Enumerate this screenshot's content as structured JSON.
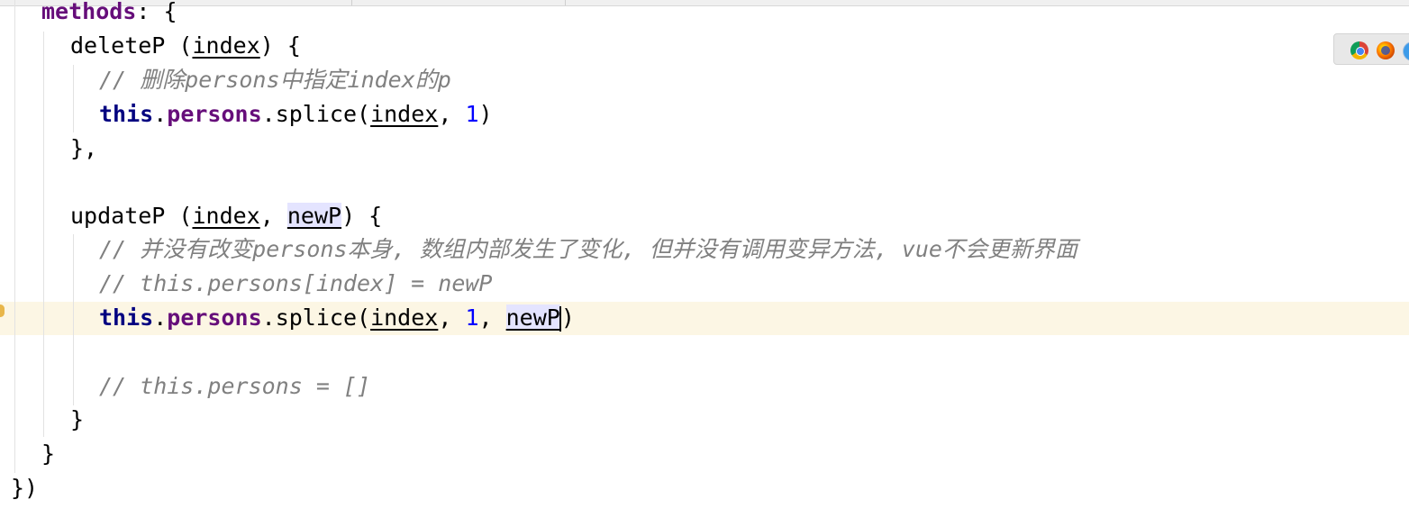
{
  "editor": {
    "lines": {
      "l0": {
        "kw": "methods",
        "rest": ": {"
      },
      "l1": {
        "name": "deleteP",
        "sp": " (",
        "p1": "index",
        "close": ") {"
      },
      "l2": {
        "comment": "// 删除persons中指定index的p"
      },
      "l3": {
        "this": "this",
        "dot1": ".",
        "prop": "persons",
        "dot2": ".",
        "fn": "splice",
        "open": "(",
        "p1": "index",
        "sep": ", ",
        "num": "1",
        "close": ")"
      },
      "l4": {
        "text": "},"
      },
      "l6": {
        "name": "updateP",
        "sp": " (",
        "p1": "index",
        "sep": ", ",
        "p2": "newP",
        "close": ") {"
      },
      "l7": {
        "comment": "// 并没有改变persons本身, 数组内部发生了变化, 但并没有调用变异方法, vue不会更新界面"
      },
      "l8": {
        "comment": "// this.persons[index] = newP"
      },
      "l9": {
        "this": "this",
        "dot1": ".",
        "prop": "persons",
        "dot2": ".",
        "fn": "splice",
        "open": "(",
        "p1": "index",
        "sep1": ", ",
        "num": "1",
        "sep2": ", ",
        "p2": "newP",
        "close": ")"
      },
      "l11": {
        "comment": "// this.persons = []"
      },
      "l12": {
        "text": "}"
      },
      "l13": {
        "text": "}"
      },
      "l14": {
        "text": "})"
      }
    }
  },
  "browser_icons": [
    "chrome-icon",
    "firefox-icon",
    "safari-icon"
  ],
  "colors": {
    "keyword": "#000080",
    "property": "#660e7a",
    "number": "#0000ff",
    "comment": "#808080",
    "current_line": "#fcf6e4",
    "identifier_highlight": "#e4e4ff"
  }
}
